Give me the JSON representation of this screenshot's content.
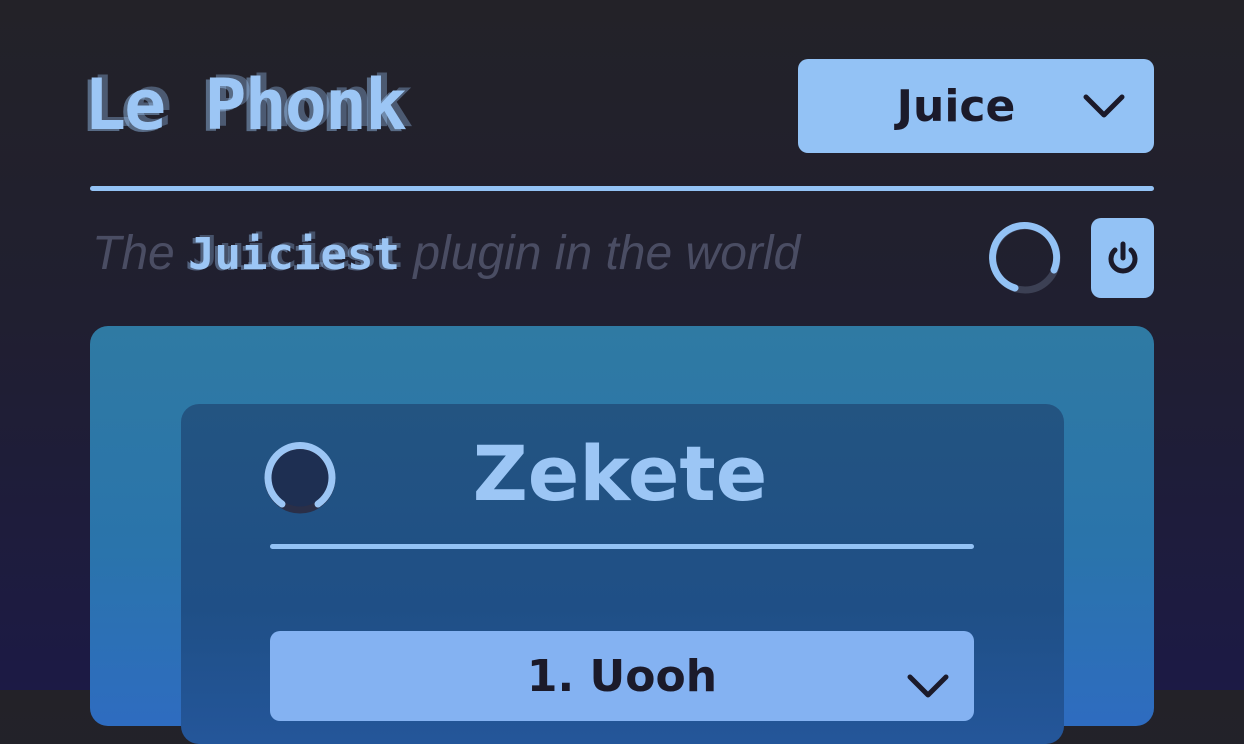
{
  "header": {
    "logo_text": "Le Phonk",
    "preset_select": {
      "value": "Juice",
      "icon": "chevron-down-icon"
    }
  },
  "tagline": {
    "prefix": "The",
    "emphasis": "Juiciest",
    "suffix": "plugin in the world"
  },
  "controls": {
    "loading_icon": "spinner-icon",
    "power_icon": "power-icon"
  },
  "module": {
    "title": "Zekete",
    "mode_select": {
      "value": "1. Uooh",
      "icon": "chevron-down-icon"
    }
  },
  "colors": {
    "accent": "#93c2f5",
    "background": "#201f30",
    "panel_outer": "#2f7aa3",
    "panel_inner": "#235481"
  }
}
